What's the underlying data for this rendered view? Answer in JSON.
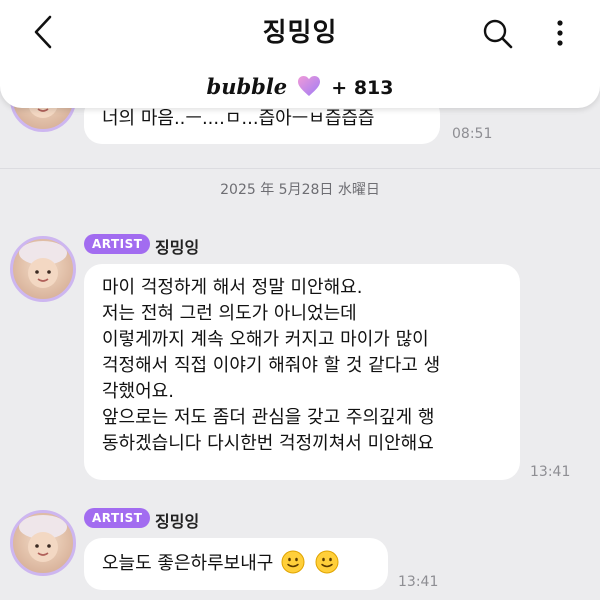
{
  "header": {
    "title": "징밍잉",
    "brand": "bubble",
    "count": "+ 813",
    "icons": {
      "back": "chevron-left-icon",
      "search": "search-icon",
      "more": "more-vertical-icon",
      "heart": "heart-icon"
    },
    "heart_colors": [
      "#f09ad8",
      "#9f7cf5"
    ]
  },
  "messages": [
    {
      "text_lines": [
        "너의 마음..ㅡ....ㅁ...즙아ㅡㅂ즙즙즙"
      ],
      "time": "08:51"
    }
  ],
  "date_separator": "2025 年 5月28日 水曜日",
  "groups": [
    {
      "badge": "ARTIST",
      "sender": "징밍잉",
      "text_lines": [
        "마이 걱정하게 해서 정말 미안해요.",
        "저는 전혀 그런 의도가 아니었는데",
        "이렇게까지 계속 오해가 커지고  마이가 많이",
        "걱정해서 직접 이야기 해줘야 할 것 같다고 생",
        "각했어요.",
        "앞으로는 저도 좀더 관심을 갖고 주의깊게 행",
        "동하겠습니다 다시한번 걱정끼쳐서 미안해요"
      ],
      "time": "13:41"
    },
    {
      "badge": "ARTIST",
      "sender": "징밍잉",
      "text": "오늘도 좋은하루보내구",
      "emojis": [
        "smiley-emoji",
        "smiley-emoji"
      ],
      "time": "13:41"
    }
  ],
  "colors": {
    "accent": "#a26cf0",
    "background": "#ececee",
    "bubble": "#ffffff",
    "avatar_ring": "#cdb6f0"
  }
}
